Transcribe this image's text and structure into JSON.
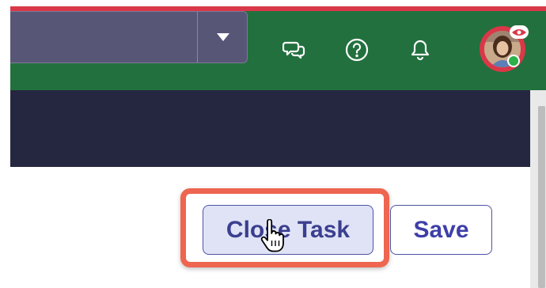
{
  "header": {
    "search": {
      "value": "",
      "placeholder": ""
    },
    "dropdown_icon": "caret-down-icon",
    "icons": [
      "chat-icon",
      "help-icon",
      "bell-icon"
    ],
    "avatar": {
      "status": "online"
    }
  },
  "actions": {
    "close_task_label": "Close Task",
    "save_label": "Save"
  },
  "colors": {
    "topbar": "#22703e",
    "dark_band": "#252741",
    "accent_red": "#d93848",
    "highlight": "#ee6550",
    "button_text": "#3b3f8f"
  }
}
